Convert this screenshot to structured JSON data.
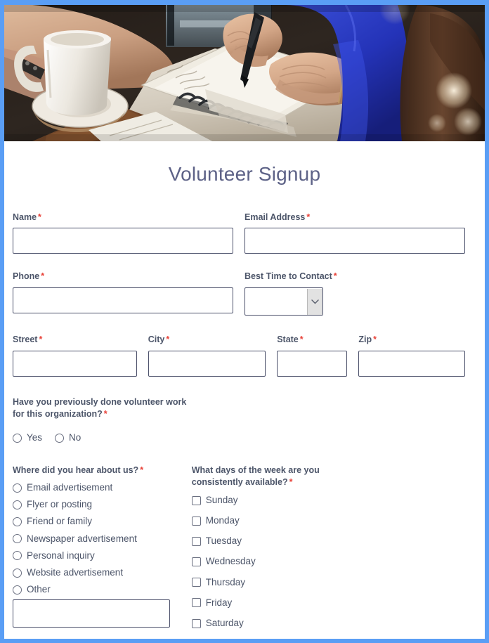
{
  "theme": {
    "accent": "#5a9ef5",
    "title_color": "#5d6287",
    "label_color": "#4c5569",
    "required_color": "#e8433a",
    "input_border": "#4b506a"
  },
  "header": {
    "image_alt": "Two people at a wooden cafe table with a spiral notebook, pen and a white coffee mug on a saucer"
  },
  "form": {
    "title": "Volunteer Signup",
    "required_marker": "*",
    "fields": {
      "name": {
        "label": "Name",
        "value": "",
        "placeholder": "",
        "required": true
      },
      "email": {
        "label": "Email Address",
        "value": "",
        "placeholder": "",
        "required": true
      },
      "phone": {
        "label": "Phone",
        "value": "",
        "placeholder": "",
        "required": true
      },
      "best_time": {
        "label": "Best Time to Contact",
        "value": "",
        "required": true,
        "icon": "chevron-down-icon",
        "options": [
          ""
        ]
      },
      "street": {
        "label": "Street",
        "value": "",
        "placeholder": "",
        "required": true
      },
      "city": {
        "label": "City",
        "value": "",
        "placeholder": "",
        "required": true
      },
      "state": {
        "label": "State",
        "value": "",
        "placeholder": "",
        "required": true
      },
      "zip": {
        "label": "Zip",
        "value": "",
        "placeholder": "",
        "required": true
      }
    },
    "previous_volunteer": {
      "label": "Have you previously done volunteer work for this organization?",
      "required": true,
      "options": [
        {
          "label": "Yes",
          "selected": false
        },
        {
          "label": "No",
          "selected": false
        }
      ]
    },
    "hear_about": {
      "label": "Where did you hear about us?",
      "required": true,
      "options": [
        {
          "label": "Email advertisement",
          "selected": false
        },
        {
          "label": "Flyer or posting",
          "selected": false
        },
        {
          "label": "Friend or family",
          "selected": false
        },
        {
          "label": "Newspaper advertisement",
          "selected": false
        },
        {
          "label": "Personal inquiry",
          "selected": false
        },
        {
          "label": "Website advertisement",
          "selected": false
        },
        {
          "label": "Other",
          "selected": false
        }
      ],
      "other_value": "",
      "other_placeholder": ""
    },
    "available_days": {
      "label": "What days of the week are you consistently available?",
      "required": true,
      "options": [
        {
          "label": "Sunday",
          "checked": false
        },
        {
          "label": "Monday",
          "checked": false
        },
        {
          "label": "Tuesday",
          "checked": false
        },
        {
          "label": "Wednesday",
          "checked": false
        },
        {
          "label": "Thursday",
          "checked": false
        },
        {
          "label": "Friday",
          "checked": false
        },
        {
          "label": "Saturday",
          "checked": false
        }
      ]
    }
  }
}
